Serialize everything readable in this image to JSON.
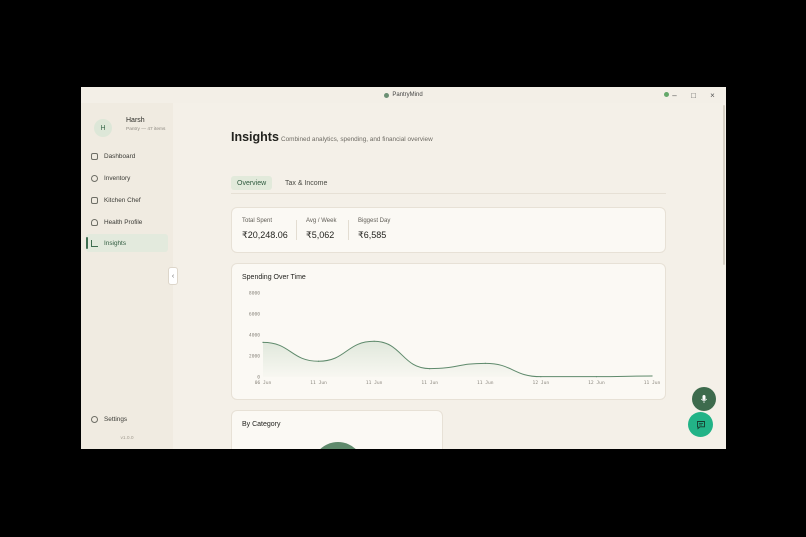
{
  "window": {
    "title": "PantryMind",
    "controls": [
      "–",
      "□",
      "×"
    ]
  },
  "profile": {
    "initial": "H",
    "name": "Harsh",
    "subtitle": "Pantry — 47 items"
  },
  "sidebar": {
    "items": [
      {
        "label": "Dashboard",
        "icon": "grid-icon"
      },
      {
        "label": "Inventory",
        "icon": "box-icon"
      },
      {
        "label": "Kitchen Chef",
        "icon": "chef-hat-icon"
      },
      {
        "label": "Health Profile",
        "icon": "heart-icon"
      },
      {
        "label": "Insights",
        "icon": "bar-chart-icon",
        "active": true
      }
    ],
    "settings_label": "Settings",
    "version": "v1.0.0",
    "collapse_glyph": "‹"
  },
  "page": {
    "title": "Insights",
    "subtitle": "Combined analytics, spending, and financial overview",
    "tabs": [
      {
        "label": "Overview",
        "active": true
      },
      {
        "label": "Tax & Income",
        "active": false
      }
    ]
  },
  "stats": [
    {
      "label": "Total Spent",
      "value": "₹20,248.06"
    },
    {
      "label": "Avg / Week",
      "value": "₹5,062"
    },
    {
      "label": "Biggest Day",
      "value": "₹6,585"
    }
  ],
  "chart_data": {
    "type": "area",
    "title": "Spending Over Time",
    "x": [
      "06 Jun",
      "11 Jun",
      "11 Jun",
      "11 Jun",
      "11 Jun",
      "12 Jun",
      "12 Jun",
      "11 Jun"
    ],
    "y": [
      3300,
      1500,
      3400,
      800,
      1300,
      30,
      30,
      100
    ],
    "yticks": [
      0,
      2000,
      4000,
      6000,
      8000
    ],
    "ylim": [
      0,
      8000
    ],
    "grid": false,
    "colors": {
      "line": "#5f8a6c",
      "fill": "#dde6d9"
    }
  },
  "category_card": {
    "title": "By Category"
  },
  "colors": {
    "accent": "#3d6b4d",
    "accent_bright": "#22b387",
    "background": "#f4f0e8"
  }
}
